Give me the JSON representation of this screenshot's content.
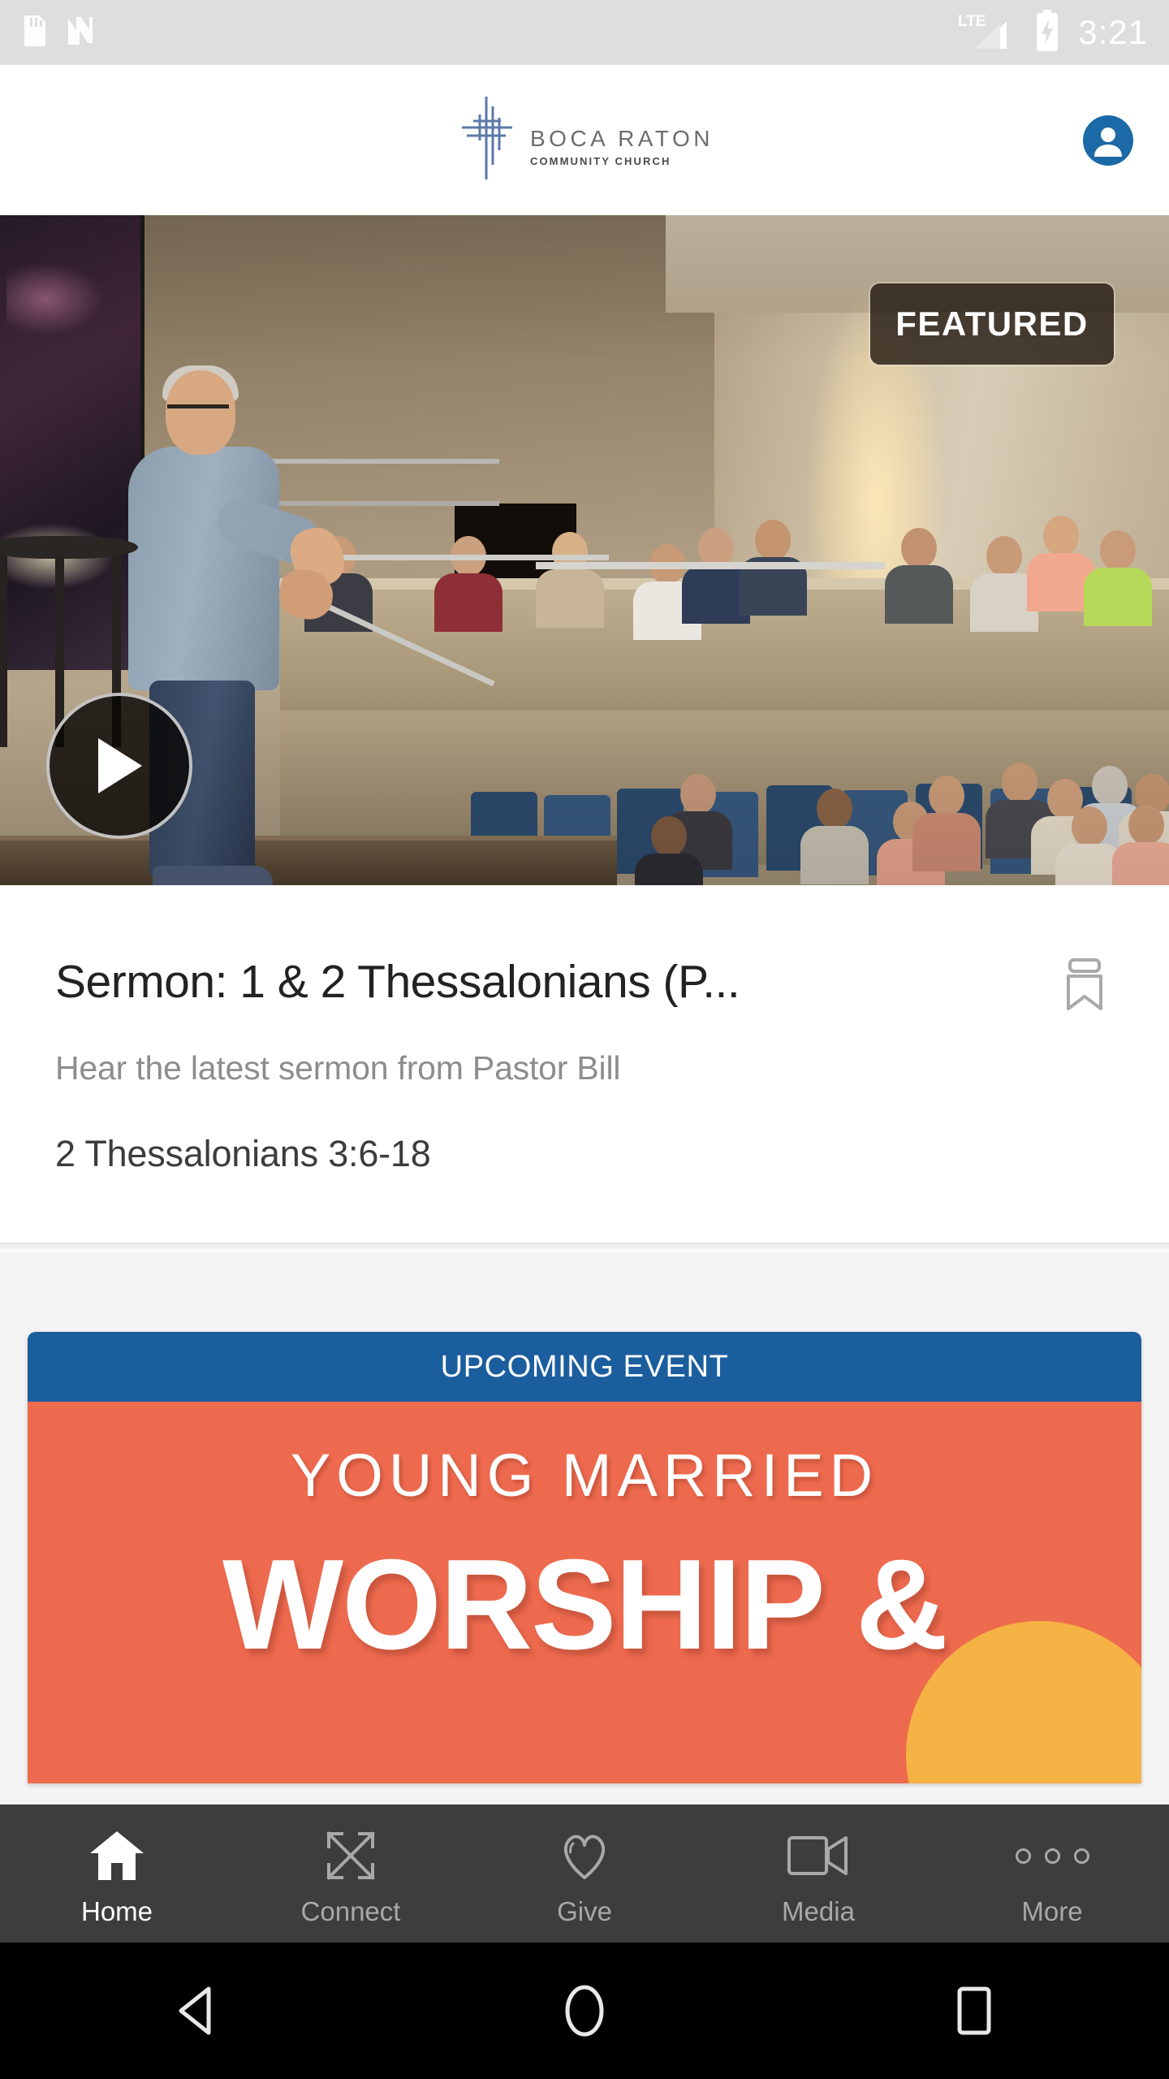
{
  "statusbar": {
    "time": "3:21",
    "icons": [
      "sd-card-icon",
      "nfc-icon",
      "lte-signal-icon",
      "battery-charging-icon"
    ],
    "network_label": "LTE"
  },
  "header": {
    "logo_main": "BOCA RATON",
    "logo_sub": "COMMUNITY CHURCH",
    "logo_icon": "cross-icon",
    "account_icon": "account-avatar-icon",
    "accent_color": "#1b69a6"
  },
  "hero": {
    "badge": "FEATURED",
    "play_icon": "play-icon",
    "badge_bg": "#221810"
  },
  "sermon": {
    "title": "Sermon: 1 & 2 Thessalonians (P...",
    "subtitle": "Hear the latest sermon from Pastor Bill",
    "reference": "2 Thessalonians 3:6-18",
    "bookmark_icon": "bookmark-icon"
  },
  "event": {
    "banner_label": "UPCOMING EVENT",
    "banner_color": "#1b5e9e",
    "poster_bg": "#ee6a4e",
    "poster_line1": "YOUNG MARRIED",
    "poster_line2": "WORSHIP &"
  },
  "bottom_nav": {
    "items": [
      {
        "label": "Home",
        "icon": "home-icon",
        "active": true
      },
      {
        "label": "Connect",
        "icon": "connect-icon",
        "active": false
      },
      {
        "label": "Give",
        "icon": "heart-icon",
        "active": false
      },
      {
        "label": "Media",
        "icon": "video-camera-icon",
        "active": false
      },
      {
        "label": "More",
        "icon": "more-dots-icon",
        "active": false
      }
    ],
    "bg_color": "#3d3d3d",
    "active_color": "#ffffff",
    "inactive_color": "#a8a8a8"
  },
  "android_nav": {
    "back": "back-triangle-icon",
    "home": "home-circle-icon",
    "recents": "recents-square-icon"
  }
}
